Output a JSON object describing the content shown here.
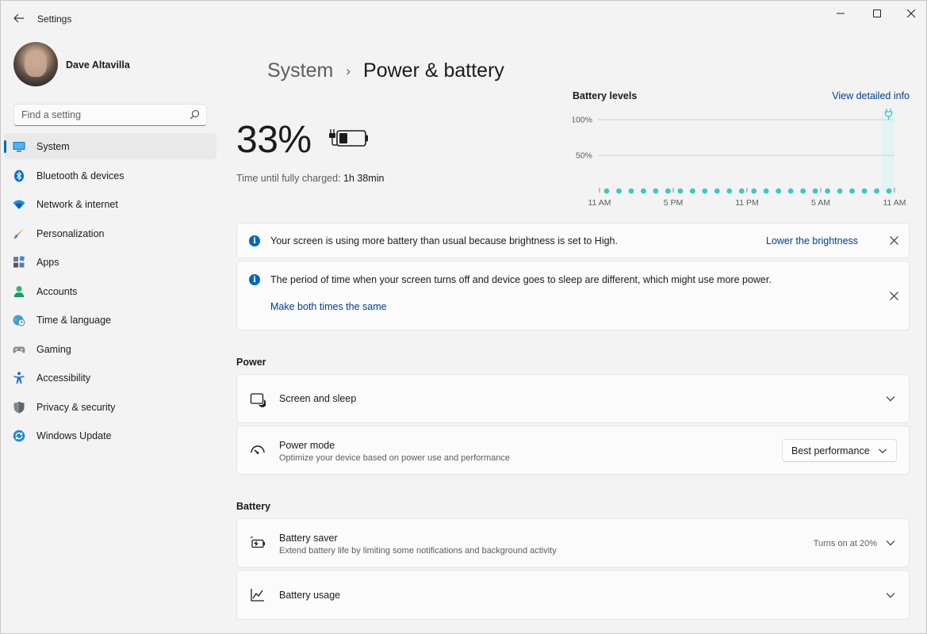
{
  "window": {
    "title": "Settings",
    "back_icon": "arrow-left-icon",
    "controls": [
      "minimize-icon",
      "maximize-icon",
      "close-icon"
    ]
  },
  "profile": {
    "name": "Dave Altavilla"
  },
  "search": {
    "placeholder": "Find a setting"
  },
  "nav": {
    "items": [
      {
        "label": "System",
        "icon": "system-icon",
        "active": true
      },
      {
        "label": "Bluetooth & devices",
        "icon": "bluetooth-icon"
      },
      {
        "label": "Network & internet",
        "icon": "wifi-icon"
      },
      {
        "label": "Personalization",
        "icon": "brush-icon"
      },
      {
        "label": "Apps",
        "icon": "apps-icon"
      },
      {
        "label": "Accounts",
        "icon": "person-icon"
      },
      {
        "label": "Time & language",
        "icon": "globe-clock-icon"
      },
      {
        "label": "Gaming",
        "icon": "gamepad-icon"
      },
      {
        "label": "Accessibility",
        "icon": "accessibility-icon"
      },
      {
        "label": "Privacy & security",
        "icon": "shield-icon"
      },
      {
        "label": "Windows Update",
        "icon": "update-icon"
      }
    ]
  },
  "header": {
    "parent": "System",
    "separator": "›",
    "current": "Power & battery"
  },
  "battery": {
    "percent_label": "33%",
    "charge_label": "Time until fully charged:",
    "charge_value": "1h 38min"
  },
  "battery_levels": {
    "title": "Battery levels",
    "link": "View detailed info",
    "accent": "#3cc8c4",
    "chart_data": {
      "type": "scatter",
      "title": "Battery levels",
      "y_ticks": [
        "100%",
        "50%"
      ],
      "x_ticks": [
        "11 AM",
        "5 PM",
        "11 PM",
        "5 AM",
        "11 AM"
      ],
      "ylim": [
        0,
        100
      ],
      "points_count": 24,
      "values": [
        0,
        0,
        0,
        0,
        0,
        0,
        0,
        0,
        0,
        0,
        0,
        0,
        0,
        0,
        0,
        0,
        0,
        0,
        0,
        0,
        0,
        0,
        0,
        0
      ],
      "charging_marker": "plug-icon",
      "grid": true
    }
  },
  "notices": [
    {
      "icon": "info-icon",
      "text": "Your screen is using more battery than usual because brightness is set to High.",
      "link": "Lower the brightness",
      "close_icon": "close-icon"
    },
    {
      "icon": "info-icon",
      "text": "The period of time when your screen turns off and device goes to sleep are different, which might use more power.",
      "link": "Make both times the same",
      "close_icon": "close-icon"
    }
  ],
  "power": {
    "section_title": "Power",
    "screen_sleep": {
      "title": "Screen and sleep",
      "icon": "screen-sleep-icon"
    },
    "power_mode": {
      "title": "Power mode",
      "subtitle": "Optimize your device based on power use and performance",
      "icon": "gauge-icon",
      "value": "Best performance"
    }
  },
  "battery_section": {
    "section_title": "Battery",
    "saver": {
      "title": "Battery saver",
      "subtitle": "Extend battery life by limiting some notifications and background activity",
      "status": "Turns on at 20%",
      "icon": "battery-saver-icon"
    },
    "usage": {
      "title": "Battery usage",
      "icon": "line-chart-icon"
    }
  }
}
